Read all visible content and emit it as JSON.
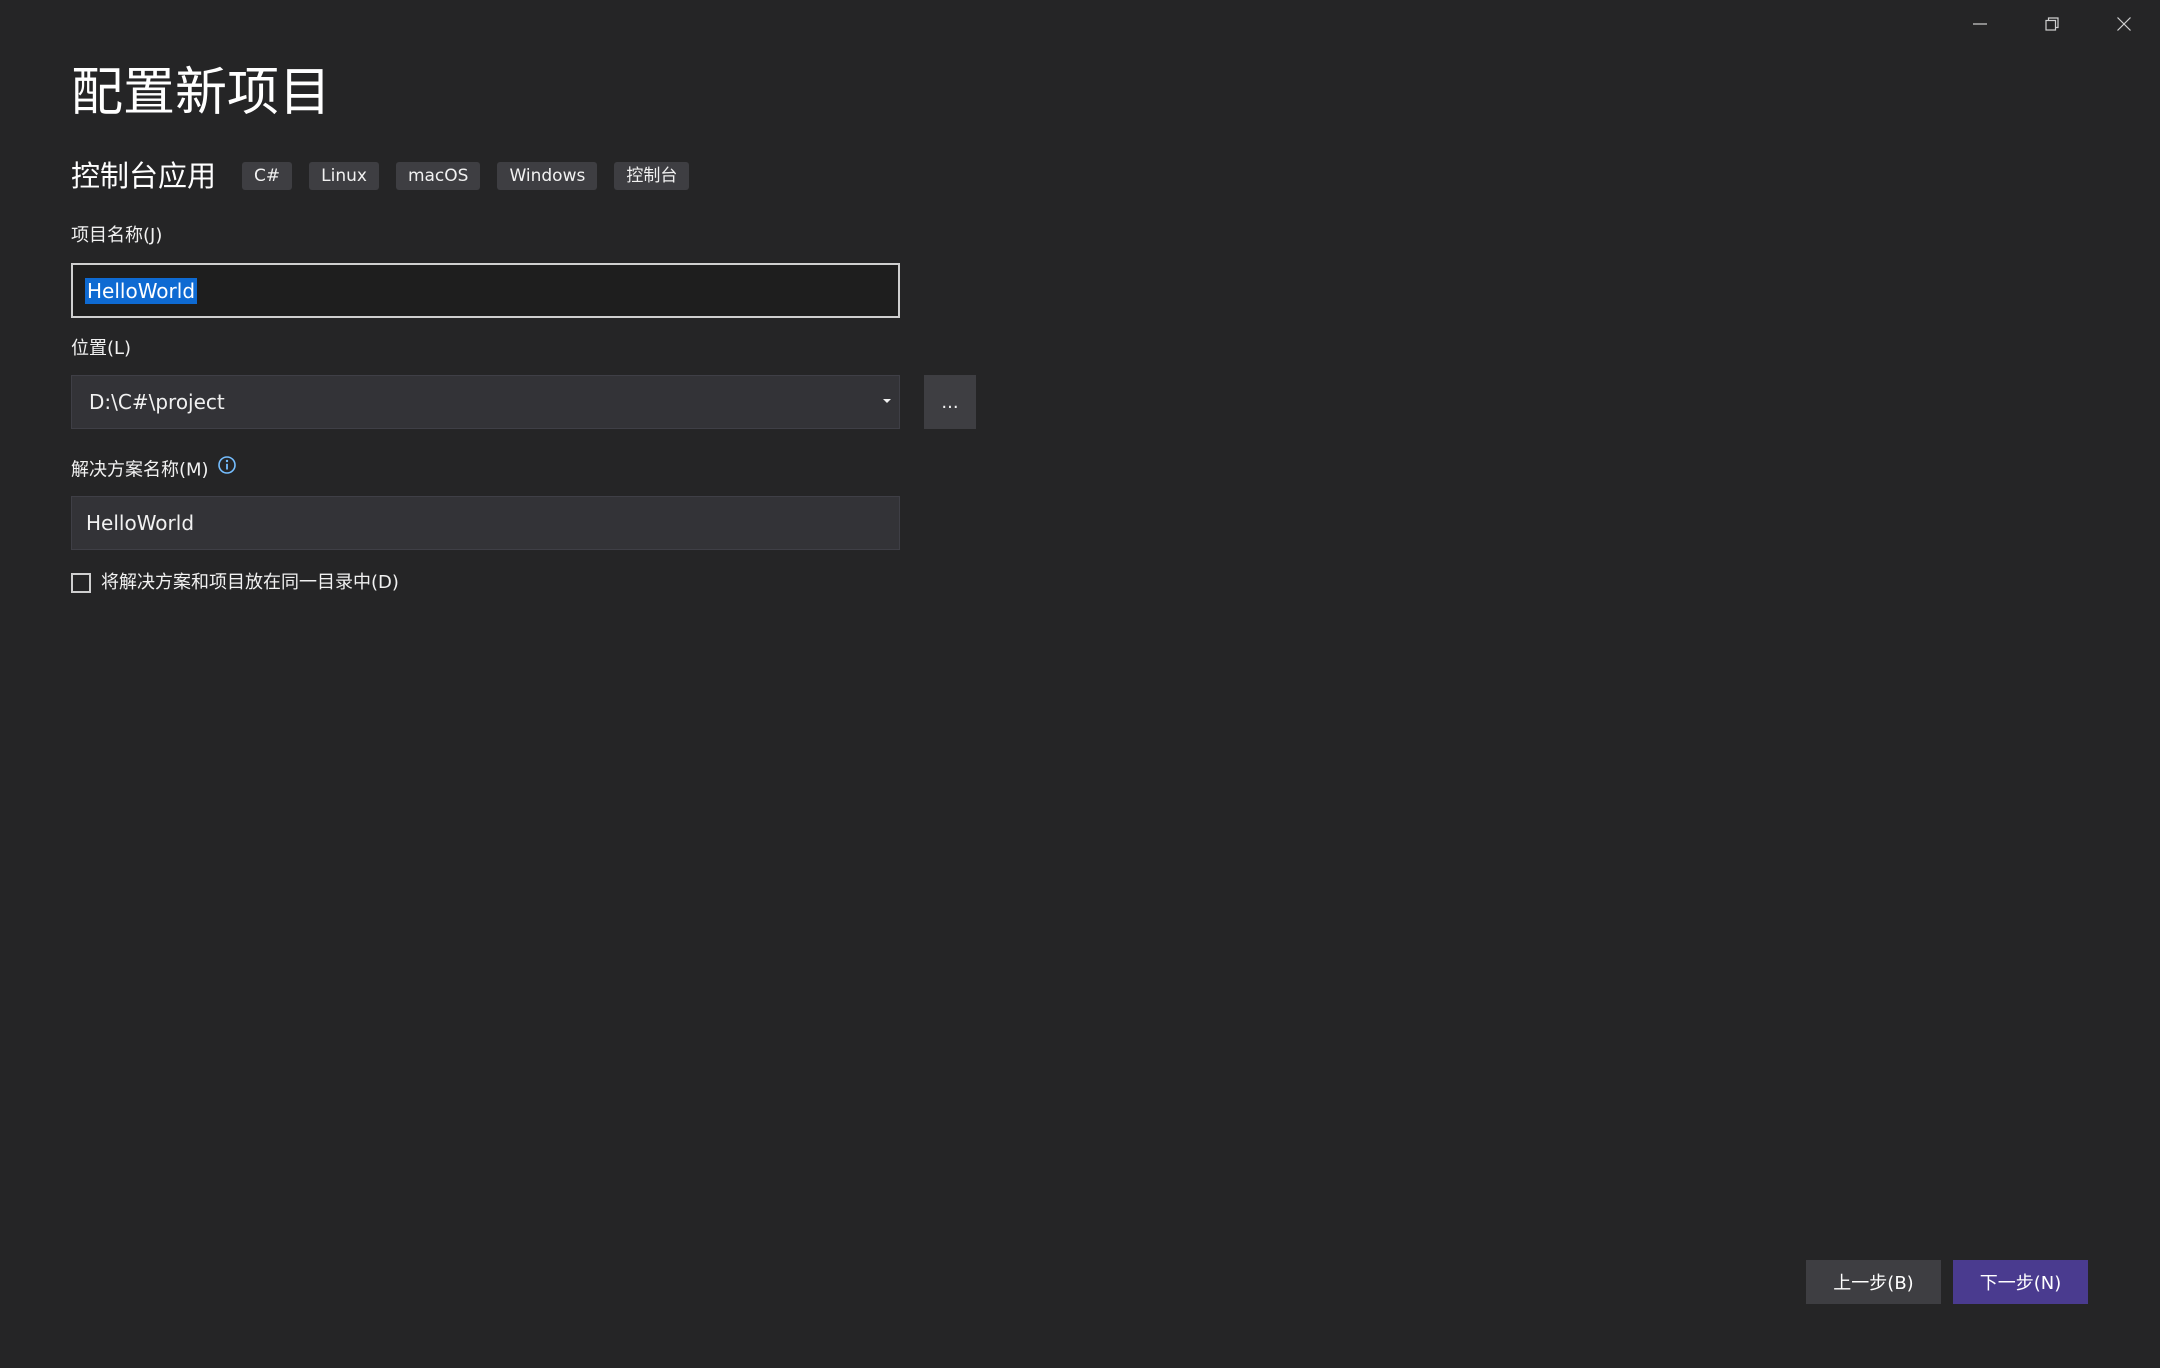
{
  "window": {
    "controls": {
      "minimize_icon": "minimize-icon",
      "restore_icon": "restore-icon",
      "close_icon": "close-icon"
    }
  },
  "header": {
    "title": "配置新项目"
  },
  "template": {
    "name": "控制台应用",
    "tags": [
      "C#",
      "Linux",
      "macOS",
      "Windows",
      "控制台"
    ]
  },
  "form": {
    "project_name": {
      "label": "项目名称(J)",
      "value": "HelloWorld"
    },
    "location": {
      "label": "位置(L)",
      "value": "D:\\C#\\project",
      "browse_label": "..."
    },
    "solution_name": {
      "label": "解决方案名称(M)",
      "value": "HelloWorld",
      "info_icon": "info-icon"
    },
    "same_directory": {
      "label": "将解决方案和项目放在同一目录中(D)",
      "checked": false
    }
  },
  "footer": {
    "back_label": "上一步(B)",
    "next_label": "下一步(N)"
  },
  "colors": {
    "background": "#252526",
    "input_background": "#333337",
    "tag_background": "#3e3e42",
    "selection": "#0e6ad2",
    "primary_button": "#4a3b8f",
    "info_icon": "#75beff"
  }
}
